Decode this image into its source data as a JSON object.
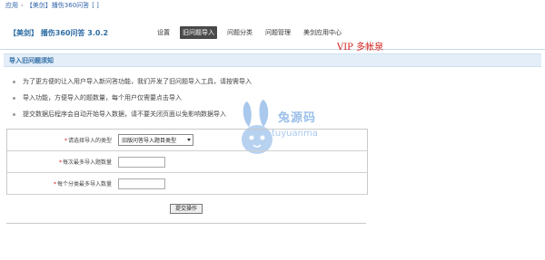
{
  "breadcrumb": {
    "items": [
      "应用",
      "【美剑】播伤360问答",
      "[ ]"
    ]
  },
  "header": {
    "title": "【美剑】 播伤360问答 3.0.2",
    "nav": [
      {
        "label": "设置",
        "active": false
      },
      {
        "label": "旧问题导入",
        "active": true
      },
      {
        "label": "问题分类",
        "active": false
      },
      {
        "label": "问题管理",
        "active": false
      },
      {
        "label": "美剑应用中心",
        "active": false
      }
    ],
    "vip_label": "VIP 多帐泉"
  },
  "section": {
    "title": "导入旧问题须知"
  },
  "notes": [
    "为了更方便的让入用户导入新问答功能，我们开发了旧问题导入工具，请按需导入",
    "导入功能，方便导入的题数量，每个用户仅需要点击导入",
    "提交数据后程序会自动开始导入数据，请不要关闭页面以免影响数据导入"
  ],
  "watermark": {
    "zh": "兔源码",
    "en": "tuyuanma"
  },
  "form": {
    "rows": [
      {
        "label": "请选择导入的类型",
        "type": "select",
        "value": "旧版问答导入题目类型"
      },
      {
        "label": "每次最多导入题数量",
        "type": "input",
        "value": ""
      },
      {
        "label": "每个分类最多导入数量",
        "type": "input",
        "value": ""
      }
    ],
    "submit_label": "提交操作"
  },
  "colors": {
    "accent": "#2f6da6",
    "vip": "#d2201b",
    "section_bg": "#e4eef8",
    "nav_active_bg": "#4a4a4a",
    "watermark": "#9cc0ea"
  }
}
